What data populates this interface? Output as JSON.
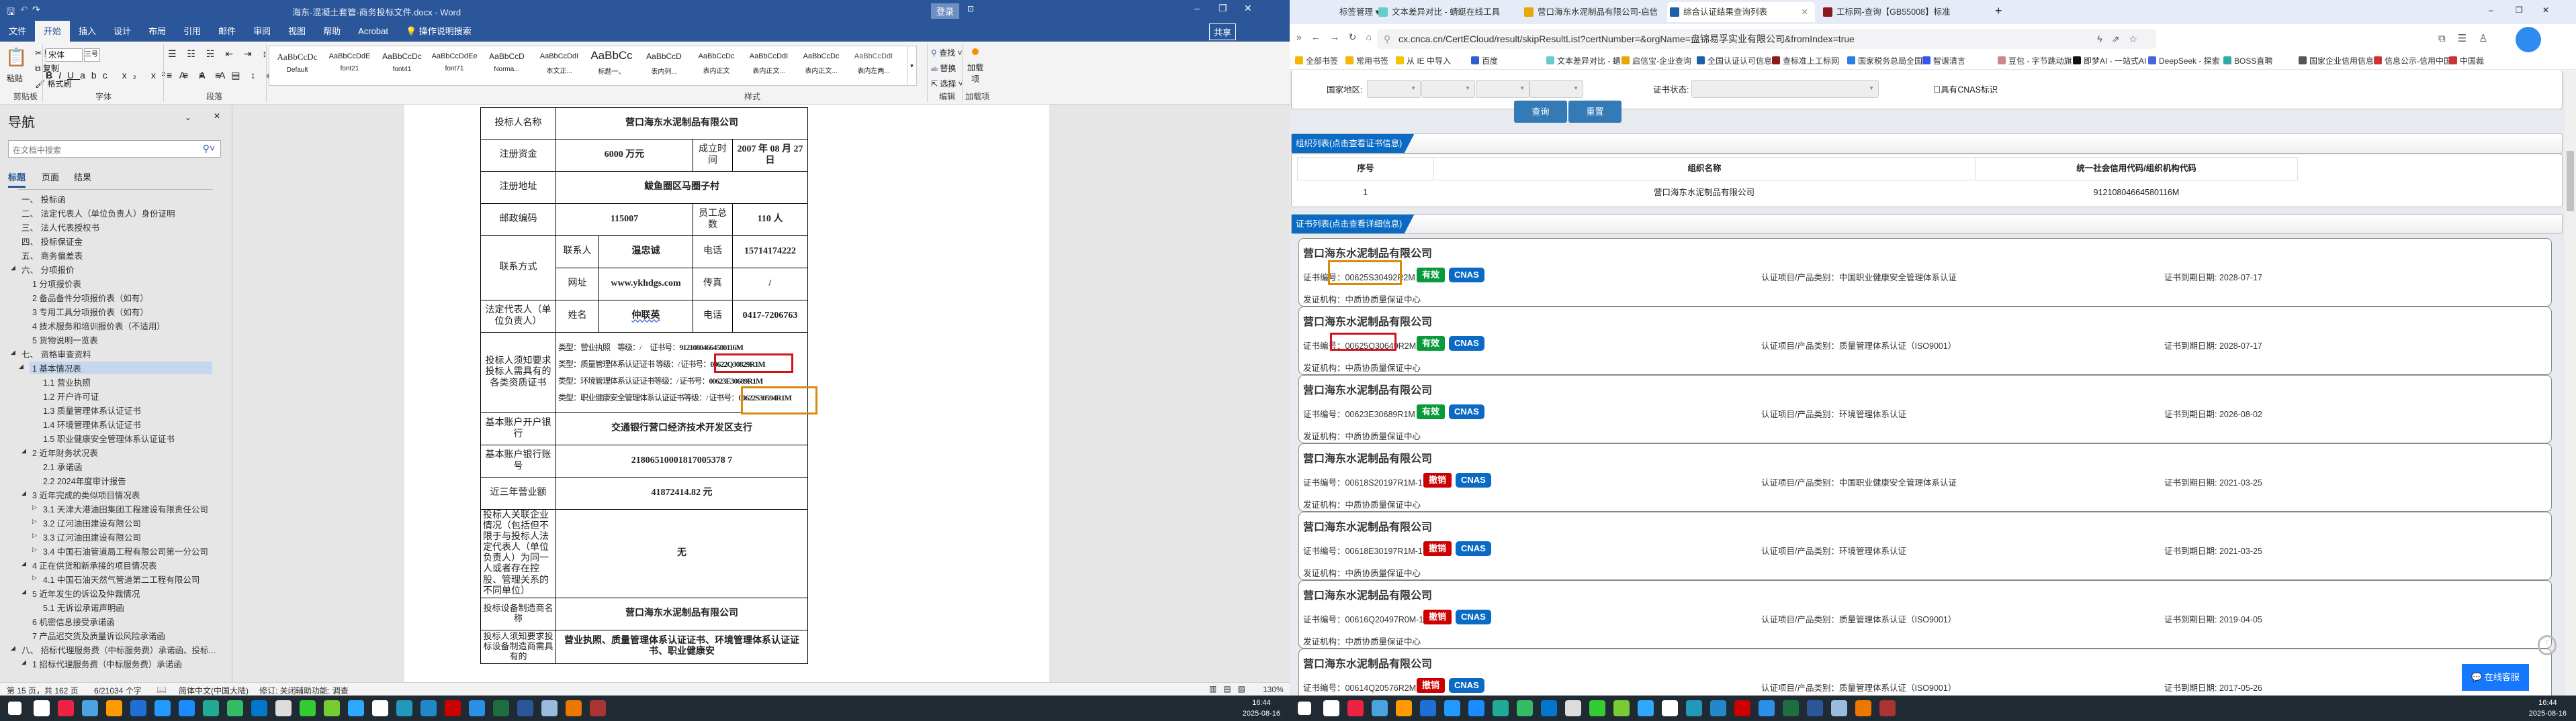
{
  "word": {
    "title": "海东-混凝土套管-商务投标文件.docx - Word",
    "login": "登录",
    "share": "共享",
    "tabs": [
      "文件",
      "开始",
      "插入",
      "设计",
      "布局",
      "引用",
      "邮件",
      "审阅",
      "视图",
      "帮助",
      "Acrobat",
      "操作说明搜索"
    ],
    "ribbon": {
      "clipboard": {
        "paste": "粘贴",
        "cut": "剪切",
        "copy": "复制",
        "format_painter": "格式刷",
        "label": "剪贴板"
      },
      "font": {
        "name": "宋体",
        "size": "三号",
        "label": "字体"
      },
      "paragraph": {
        "label": "段落"
      },
      "styles": {
        "items": [
          "Default",
          "font21",
          "font41",
          "font71",
          "Norma...",
          "本文正...",
          "标题一、",
          "表内列...",
          "表内正文",
          "表内正文...",
          "表内正文...",
          "表内左两..."
        ],
        "label": "样式"
      },
      "editing": {
        "find": "查找",
        "replace": "替换",
        "select": "选择",
        "label": "编辑"
      },
      "addins": {
        "button": "加载项",
        "label": "加载项"
      }
    },
    "nav": {
      "title": "导航",
      "search_placeholder": "在文档中搜索",
      "tabs": [
        "标题",
        "页面",
        "结果"
      ],
      "items": [
        {
          "text": "一、 投标函",
          "level": 0
        },
        {
          "text": "二、 法定代表人（单位负责人）身份证明",
          "level": 0
        },
        {
          "text": "三、 法人代表授权书",
          "level": 0
        },
        {
          "text": "四、 投标保证金",
          "level": 0
        },
        {
          "text": "五、 商务偏差表",
          "level": 0
        },
        {
          "text": "六、 分项报价",
          "level": 0,
          "exp": "◢"
        },
        {
          "text": "1 分项报价表",
          "level": 1
        },
        {
          "text": "2 备品备件分项报价表（如有）",
          "level": 1
        },
        {
          "text": "3 专用工具分项报价表（如有）",
          "level": 1
        },
        {
          "text": "4 技术服务和培训报价表（不适用）",
          "level": 1
        },
        {
          "text": "5 货物说明一览表",
          "level": 1
        },
        {
          "text": "七、 资格审查资料",
          "level": 0,
          "exp": "◢"
        },
        {
          "text": "1 基本情况表",
          "level": 1,
          "exp": "◢",
          "selected": true
        },
        {
          "text": "1.1 营业执照",
          "level": 2
        },
        {
          "text": "1.2 开户许可证",
          "level": 2
        },
        {
          "text": "1.3 质量管理体系认证证书",
          "level": 2
        },
        {
          "text": "1.4 环境管理体系认证证书",
          "level": 2
        },
        {
          "text": "1.5 职业健康安全管理体系认证证书",
          "level": 2
        },
        {
          "text": "2 近年财务状况表",
          "level": 1,
          "exp": "◢"
        },
        {
          "text": "2.1 承诺函",
          "level": 2
        },
        {
          "text": "2.2 2024年度审计报告",
          "level": 2
        },
        {
          "text": "3 近年完成的类似项目情况表",
          "level": 1,
          "exp": "◢"
        },
        {
          "text": "3.1 天津大港油田集团工程建设有限责任公司",
          "level": 2,
          "exp": "▷"
        },
        {
          "text": "3.2 辽河油田建设有限公司",
          "level": 2,
          "exp": "▷"
        },
        {
          "text": "3.3 辽河油田建设有限公司",
          "level": 2,
          "exp": "▷"
        },
        {
          "text": "3.4 中国石油管道局工程有限公司第一分公司",
          "level": 2,
          "exp": "▷"
        },
        {
          "text": "4 正在供货和新承接的项目情况表",
          "level": 1,
          "exp": "◢"
        },
        {
          "text": "4.1 中国石油天然气管道第二工程有限公司",
          "level": 2,
          "exp": "▷"
        },
        {
          "text": "5 近年发生的诉讼及仲裁情况",
          "level": 1,
          "exp": "◢"
        },
        {
          "text": "5.1 无诉讼承诺声明函",
          "level": 2
        },
        {
          "text": "6 机密信息接受承诺函",
          "level": 1
        },
        {
          "text": "7 产品迟交货及质量诉讼风险承诺函",
          "level": 1
        },
        {
          "text": "八、 招标代理服务费（中标服务费）承诺函、投标...",
          "level": 0,
          "exp": "◢"
        },
        {
          "text": "1 招标代理服务费（中标服务费）承诺函",
          "level": 1,
          "exp": "◢"
        }
      ]
    },
    "table": {
      "bidder_label": "投标人名称",
      "bidder": "营口海东水泥制品有限公司",
      "capital_label": "注册资金",
      "capital": "6000 万元",
      "founded_label": "成立时间",
      "founded": "2007 年 08 月 27 日",
      "address_label": "注册地址",
      "address": "鲅鱼圈区马圈子村",
      "postcode_label": "邮政编码",
      "postcode": "115007",
      "staff_label": "员工总数",
      "staff": "110 人",
      "contact_label": "联系方式",
      "contact_person_label": "联系人",
      "contact_person": "温忠诚",
      "phone_label": "电话",
      "phone": "15714174222",
      "web_label": "网址",
      "web": "www.ykhdgs.com",
      "fax_label": "传真",
      "fax": "/",
      "legal_label": "法定代表人（单位负责人）",
      "name_label": "姓名",
      "legal_name": "仲联英",
      "legal_phone_label": "电话",
      "legal_phone": "0417-7206763",
      "qual_label": "投标人须知要求投标人需具有的各类资质证书",
      "quals": [
        {
          "type": "类型：营业执照　等级：/　 证书号：",
          "no": "91210804664580116M"
        },
        {
          "type": "类型：质量管理体系认证证书 等级：/ 证书号：",
          "no": "00622Q30829R1M"
        },
        {
          "type": "类型：环境管理体系认证证书等级：/ 证书号：",
          "no": "00623E30689R1M"
        },
        {
          "type": "类型：职业健康安全管理体系认证证书等级：/ 证书号：",
          "no": "00622S30594R1M"
        }
      ],
      "bank_label": "基本账户开户银行",
      "bank": "交通银行营口经济技术开发区支行",
      "account_label": "基本账户银行账号",
      "account": "21806510001817005378 7",
      "revenue_label": "近三年营业额",
      "revenue": "41872414.82 元",
      "related_label": "投标人关联企业情况（包括但不限于与投标人法定代表人（单位负责人）为同一人或者存在控股、管理关系的不同单位）",
      "related": "无",
      "maker_label": "投标设备制造商名称",
      "maker": "营口海东水泥制品有限公司",
      "maker_qual_label": "投标人须知要求投标设备制造商需具有的",
      "maker_qual": "营业执照、质量管理体系认证证书、环境管理体系认证证书、职业健康安"
    },
    "status": {
      "page": "第 15 页，共 162 页",
      "words": "6/21034 个字",
      "lang": "简体中文(中国大陆)",
      "track": "修订: 关闭",
      "access": "辅助功能: 调查",
      "zoom": "130%"
    }
  },
  "browser": {
    "tabs": [
      {
        "label": "标签管理"
      },
      {
        "label": "文本差异对比 - 蜻蜓在线工具"
      },
      {
        "label": "营口海东水泥制品有限公司-启信"
      },
      {
        "label": "综合认证结果查询列表",
        "active": true
      },
      {
        "label": "工标网-查询【GB55008】标准"
      }
    ],
    "url": "cx.cnca.cn/CertECloud/result/skipResultList?certNumber=&orgName=盘锦易孚实业有限公司&fromIndex=true",
    "bookmarks": [
      "全部书签",
      "常用书签",
      "从 IE 中导入",
      "百度",
      "文本差异对比 - 蜻",
      "启信宝-企业查询",
      "全国认证认可信息",
      "查标准上工标网",
      "国家税务总局全国",
      "智谱清言",
      "豆包 - 字节跳动旗",
      "即梦AI - 一站式AI",
      "DeepSeek - 探索",
      "BOSS直聘",
      "国家企业信用信息",
      "信息公示-信用中国",
      "中国裁"
    ],
    "filters": {
      "region_label": "国家地区:",
      "status_label": "证书状态:",
      "cnas_label": "具有CNAS标识",
      "query": "查询",
      "reset": "重置"
    },
    "org_section": "组织列表(点击查看证书信息)",
    "org_table": {
      "headers": [
        "序号",
        "组织名称",
        "统一社会信用代码/组织机构代码"
      ],
      "rows": [
        [
          "1",
          "营口海东水泥制品有限公司",
          "91210804664580116M"
        ]
      ]
    },
    "cert_section": "证书列表(点击查看详细信息)",
    "certs": [
      {
        "org": "营口海东水泥制品有限公司",
        "num": "证书编号：00625S30492R2M",
        "status": "有效",
        "cnas": "CNAS",
        "issuer": "发证机构：中质协质量保证中心",
        "project": "认证项目/产品类别：中国职业健康安全管理体系认证",
        "expiry": "证书到期日期: 2028-07-17"
      },
      {
        "org": "营口海东水泥制品有限公司",
        "num": "证书编号：00625Q30649R2M",
        "status": "有效",
        "cnas": "CNAS",
        "issuer": "发证机构：中质协质量保证中心",
        "project": "认证项目/产品类别：质量管理体系认证（ISO9001）",
        "expiry": "证书到期日期: 2028-07-17"
      },
      {
        "org": "营口海东水泥制品有限公司",
        "num": "证书编号：00623E30689R1M",
        "status": "有效",
        "cnas": "CNAS",
        "issuer": "发证机构：中质协质量保证中心",
        "project": "认证项目/产品类别：环境管理体系认证",
        "expiry": "证书到期日期: 2026-08-02"
      },
      {
        "org": "营口海东水泥制品有限公司",
        "num": "证书编号：00618S20197R1M-1",
        "status": "撤销",
        "cnas": "CNAS",
        "issuer": "发证机构：中质协质量保证中心",
        "project": "认证项目/产品类别：中国职业健康安全管理体系认证",
        "expiry": "证书到期日期: 2021-03-25"
      },
      {
        "org": "营口海东水泥制品有限公司",
        "num": "证书编号：00618E30197R1M-1",
        "status": "撤销",
        "cnas": "CNAS",
        "issuer": "发证机构：中质协质量保证中心",
        "project": "认证项目/产品类别：环境管理体系认证",
        "expiry": "证书到期日期: 2021-03-25"
      },
      {
        "org": "营口海东水泥制品有限公司",
        "num": "证书编号：00616Q20497R0M-1",
        "status": "撤销",
        "cnas": "CNAS",
        "issuer": "发证机构：中质协质量保证中心",
        "project": "认证项目/产品类别：质量管理体系认证（ISO9001）",
        "expiry": "证书到期日期: 2019-04-05"
      },
      {
        "org": "营口海东水泥制品有限公司",
        "num": "证书编号：00614Q20576R2M",
        "status": "撤销",
        "cnas": "CNAS",
        "issuer": "发证机构：中质协质量保证中心",
        "project": "认证项目/产品类别：质量管理体系认证（ISO9001）",
        "expiry": "证书到期日期: 2017-05-26"
      }
    ],
    "chat": "在线客服"
  },
  "clock": {
    "time": "16:44",
    "date": "2025-08-16"
  },
  "colors": {
    "word_blue": "#2b579a",
    "valid": "#0a9a3c",
    "revoked": "#cc0000",
    "cnas": "#0b6bc4",
    "highlight_red": "#d0121b",
    "highlight_orange": "#d98a0b"
  }
}
